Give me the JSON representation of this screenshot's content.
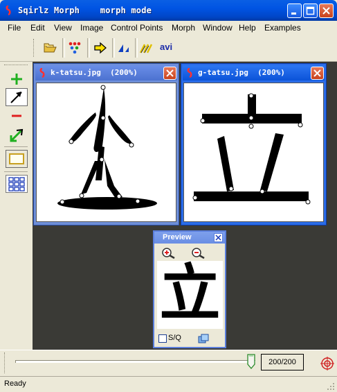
{
  "window": {
    "title": "Sqirlz Morph    morph mode"
  },
  "menu": [
    "File",
    "Edit",
    "View",
    "Image",
    "Control Points",
    "Morph",
    "Window",
    "Help",
    "Examples"
  ],
  "toolbar": {
    "avi_label": "avi"
  },
  "source_window": {
    "title": "k-tatsu.jpg  (200%)"
  },
  "target_window": {
    "title": "g-tatsu.jpg  (200%)"
  },
  "preview": {
    "title": "Preview",
    "sq_label": "S/Q",
    "glyph": "立",
    "sq_checked": false
  },
  "frame": {
    "current": 200,
    "total": 200,
    "display": "200/200"
  },
  "status": {
    "text": "Ready"
  },
  "colors": {
    "title_blue": "#0054e3",
    "mdi_background": "#3a3a36",
    "point_fill": "#ffffff"
  },
  "icons": [
    "morph-app-icon",
    "open-folder-icon",
    "control-points-icon",
    "arrow-right-icon",
    "transform-icon",
    "sequence-icon",
    "add-point-icon",
    "select-arrow-icon",
    "delete-point-icon",
    "move-point-icon",
    "rectangle-icon",
    "grid-icon",
    "zoom-in-icon",
    "zoom-out-icon",
    "copy-icon",
    "target-icon"
  ]
}
